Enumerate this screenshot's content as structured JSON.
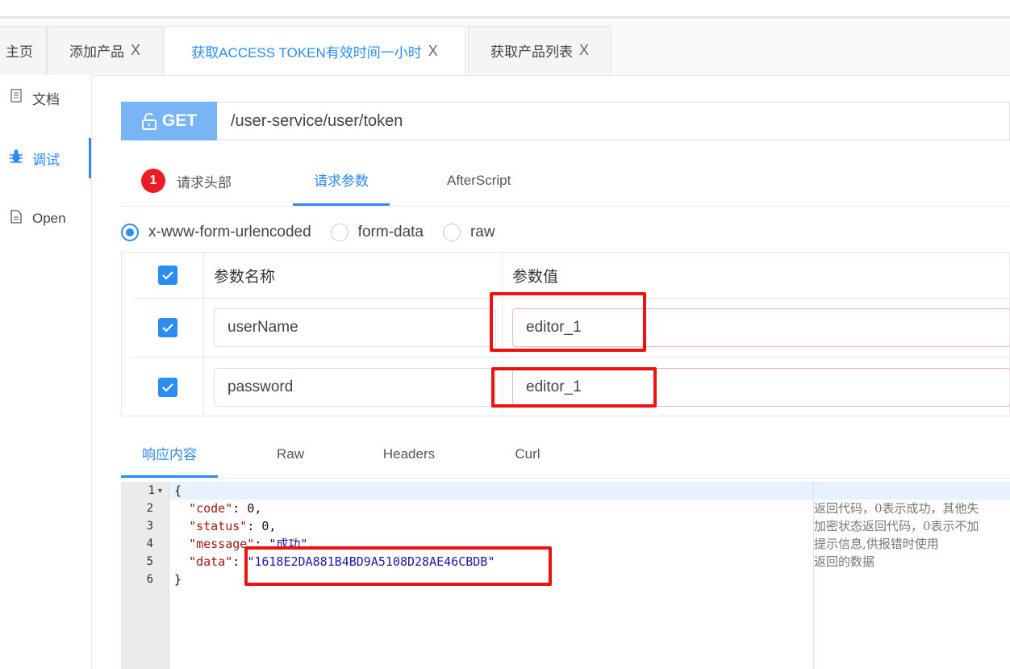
{
  "tabs": [
    {
      "label": "主页",
      "close": ""
    },
    {
      "label": "添加产品",
      "close": "X"
    },
    {
      "label": "获取ACCESS TOKEN有效时间一小时",
      "close": "X"
    },
    {
      "label": "获取产品列表",
      "close": "X"
    }
  ],
  "sidebar": {
    "items": [
      {
        "label": "文档",
        "icon": "document-icon"
      },
      {
        "label": "调试",
        "icon": "bug-icon"
      },
      {
        "label": "Open",
        "icon": "file-icon"
      }
    ]
  },
  "request": {
    "method": "GET",
    "url": "/user-service/user/token"
  },
  "subtabs": {
    "headers_badge": "1",
    "headers": "请求头部",
    "params": "请求参数",
    "afterscript": "AfterScript"
  },
  "body_types": [
    "x-www-form-urlencoded",
    "form-data",
    "raw"
  ],
  "params_table": {
    "col_name": "参数名称",
    "col_value": "参数值",
    "rows": [
      {
        "name": "userName",
        "value": "editor_1"
      },
      {
        "name": "password",
        "value": "editor_1"
      }
    ]
  },
  "response_tabs": [
    "响应内容",
    "Raw",
    "Headers",
    "Curl"
  ],
  "response": {
    "line_numbers": [
      "1",
      "2",
      "3",
      "4",
      "5",
      "6"
    ],
    "lines": {
      "l1": "{",
      "code_key": "\"code\"",
      "code_val": "0",
      "status_key": "\"status\"",
      "status_val": "0",
      "message_key": "\"message\"",
      "message_val": "\"成功\"",
      "data_key": "\"data\"",
      "data_val": "\"1618E2DA881B4BD9A5108D28AE46CBDB\"",
      "l6": "}"
    },
    "comments": [
      "返回代码，0表示成功，其他失",
      "加密状态返回代码，0表示不加",
      "提示信息,供报错时使用",
      "返回的数据"
    ]
  },
  "colors": {
    "accent": "#2d8cf0",
    "get_button": "#79b4f5",
    "highlight_box": "#ee1111",
    "badge": "#ed1c24"
  }
}
